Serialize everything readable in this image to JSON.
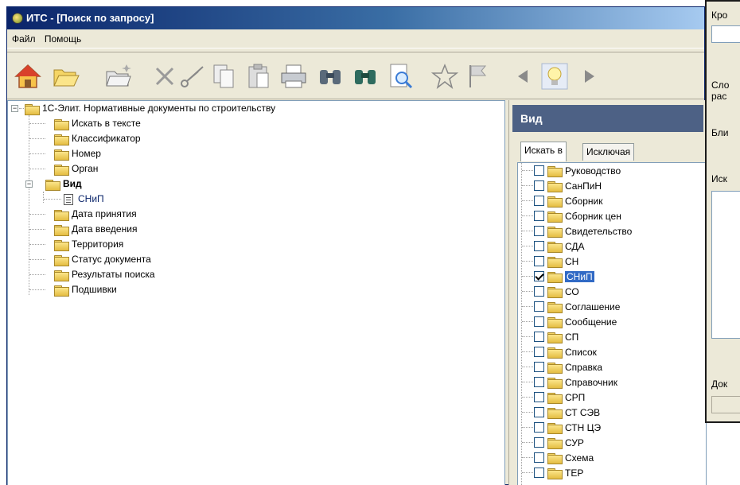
{
  "window": {
    "title": "ИТС - [Поиск по запросу]"
  },
  "menu": [
    "Файл",
    "Помощь"
  ],
  "toolbar": [
    "home-icon",
    "open-folder-icon",
    "new-folder-icon",
    "delete-icon",
    "cut-icon",
    "copy-icon",
    "paste-icon",
    "print-icon",
    "find-icon",
    "find-next-icon",
    "preview-icon",
    "favorite-icon",
    "flag-icon",
    "back-icon",
    "tip-icon",
    "forward-icon"
  ],
  "tree": {
    "root": "1С-Элит. Нормативные документы по строительству",
    "items": [
      "Искать в тексте",
      "Классификатор",
      "Номер",
      "Орган",
      "Вид",
      "СНиП",
      "Дата принятия",
      "Дата введения",
      "Территория",
      "Статус документа",
      "Результаты поиска",
      "Подшивки"
    ]
  },
  "vid": {
    "header": "Вид",
    "tabs": [
      "Искать в",
      "Исключая"
    ],
    "items": [
      {
        "label": "Руководство",
        "checked": false
      },
      {
        "label": "СанПиН",
        "checked": false
      },
      {
        "label": "Сборник",
        "checked": false
      },
      {
        "label": "Сборник цен",
        "checked": false
      },
      {
        "label": "Свидетельство",
        "checked": false
      },
      {
        "label": "СДА",
        "checked": false
      },
      {
        "label": "СН",
        "checked": false
      },
      {
        "label": "СНиП",
        "checked": true
      },
      {
        "label": "СО",
        "checked": false
      },
      {
        "label": "Соглашение",
        "checked": false
      },
      {
        "label": "Сообщение",
        "checked": false
      },
      {
        "label": "СП",
        "checked": false
      },
      {
        "label": "Список",
        "checked": false
      },
      {
        "label": "Справка",
        "checked": false
      },
      {
        "label": "Справочник",
        "checked": false
      },
      {
        "label": "СРП",
        "checked": false
      },
      {
        "label": "СТ СЭВ",
        "checked": false
      },
      {
        "label": "СТН ЦЭ",
        "checked": false
      },
      {
        "label": "СУР",
        "checked": false
      },
      {
        "label": "Схема",
        "checked": false
      },
      {
        "label": "ТЕР",
        "checked": false
      }
    ]
  },
  "dialog": {
    "labels": [
      "Кро",
      "Сло",
      "рас",
      "Бли",
      "Иск",
      "Док"
    ]
  }
}
